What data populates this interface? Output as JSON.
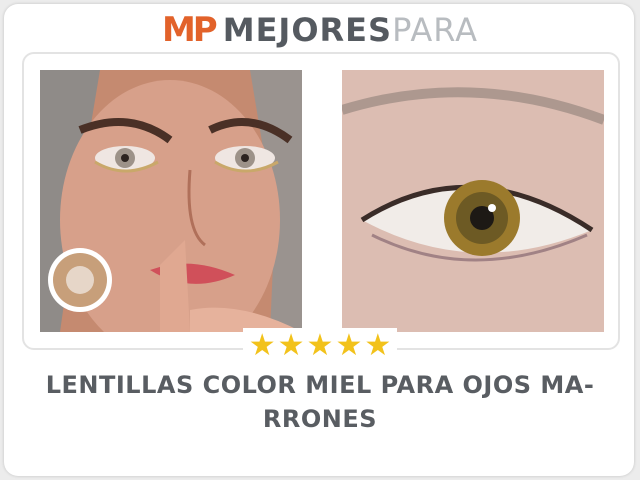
{
  "brand": {
    "logo_mark": "MP",
    "name_main": "MEJORES",
    "name_sub": "PARA",
    "logo_color": "#e2622a"
  },
  "product": {
    "images": [
      "woman-with-honey-lenses",
      "hazel-eye-closeup"
    ],
    "rating": {
      "stars": 5,
      "max": 5,
      "star_glyph": "★",
      "color": "#f2c21b"
    },
    "title_line1": "LENTILLAS COLOR MIEL PARA OJOS MA-",
    "title_line2": "RRONES"
  }
}
